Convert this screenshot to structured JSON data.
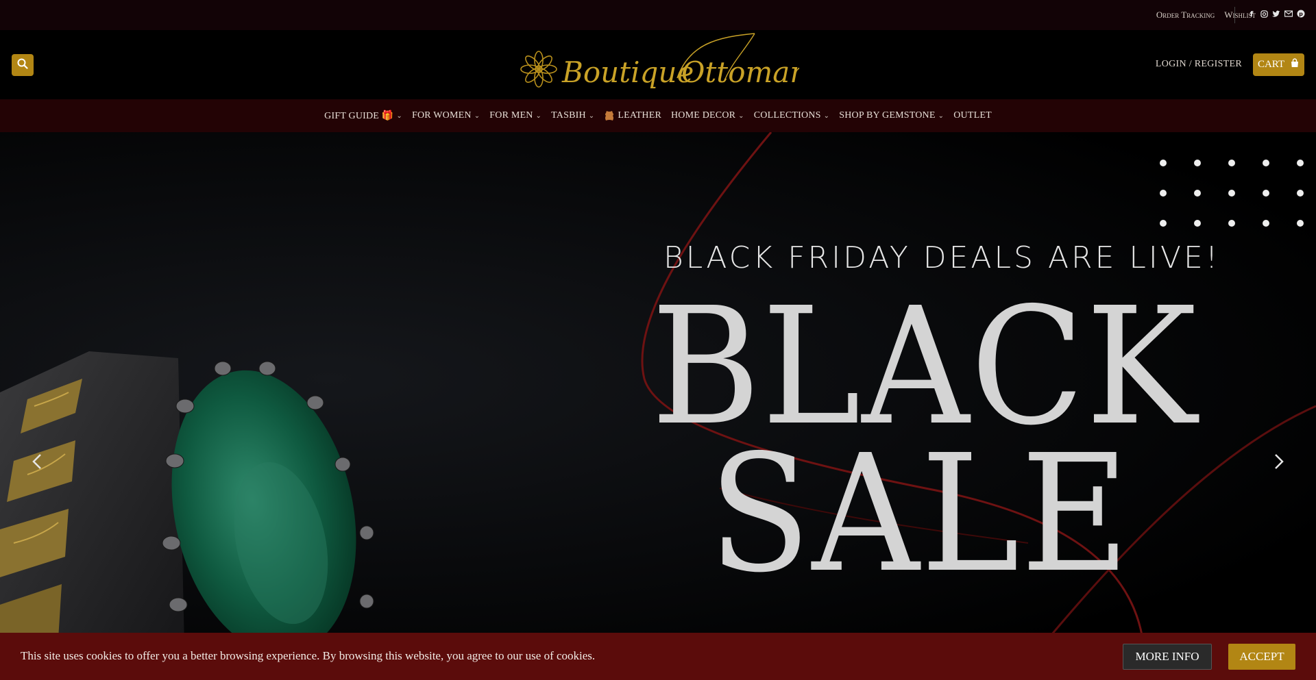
{
  "topbar": {
    "order_tracking": "Order Tracking",
    "wishlist": "Wishlist",
    "social": [
      "facebook-icon",
      "instagram-icon",
      "twitter-icon",
      "envelope-icon",
      "pinterest-icon"
    ]
  },
  "header": {
    "logo_text_1": "Boutique",
    "logo_text_2": "Ottoman",
    "login": "LOGIN / REGISTER",
    "cart": "CART"
  },
  "nav": {
    "items": [
      {
        "label": "GIFT GUIDE 🎁",
        "dropdown": true
      },
      {
        "label": "FOR WOMEN",
        "dropdown": true
      },
      {
        "label": "FOR MEN",
        "dropdown": true
      },
      {
        "label": "TASBIH",
        "dropdown": true
      },
      {
        "label": "LEATHER",
        "dropdown": false,
        "icon": "leather-icon"
      },
      {
        "label": "HOME DECOR",
        "dropdown": true
      },
      {
        "label": "COLLECTIONS",
        "dropdown": true
      },
      {
        "label": "SHOP BY GEMSTONE",
        "dropdown": true
      },
      {
        "label": "OUTLET",
        "dropdown": false
      }
    ]
  },
  "hero": {
    "subtitle": "BLACK FRIDAY DEALS ARE LIVE!",
    "title_line1": "BLACK",
    "title_line2": "SALE"
  },
  "cookie": {
    "text": "This site uses cookies to offer you a better browsing experience. By browsing this website, you agree to our use of cookies.",
    "more_info": "MORE INFO",
    "accept": "ACCEPT"
  },
  "colors": {
    "gold": "#b28614",
    "nav_bg": "#230305",
    "cookie_bg": "#5b0c0b",
    "accent_red": "#6e1212"
  }
}
